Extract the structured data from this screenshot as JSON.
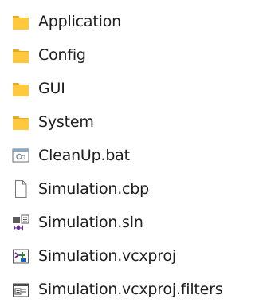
{
  "files": [
    {
      "name": "Application",
      "type": "folder",
      "icon": "folder-icon"
    },
    {
      "name": "Config",
      "type": "folder",
      "icon": "folder-icon"
    },
    {
      "name": "GUI",
      "type": "folder",
      "icon": "folder-icon"
    },
    {
      "name": "System",
      "type": "folder",
      "icon": "folder-icon"
    },
    {
      "name": "CleanUp.bat",
      "type": "batch",
      "icon": "batch-file-icon"
    },
    {
      "name": "Simulation.cbp",
      "type": "generic",
      "icon": "generic-file-icon"
    },
    {
      "name": "Simulation.sln",
      "type": "solution",
      "icon": "visual-studio-solution-icon"
    },
    {
      "name": "Simulation.vcxproj",
      "type": "project",
      "icon": "vcxproj-file-icon"
    },
    {
      "name": "Simulation.vcxproj.filters",
      "type": "filters",
      "icon": "filters-file-icon"
    }
  ],
  "colors": {
    "folder": "#FFC83D",
    "folder_shade": "#E8A920",
    "text": "#1f1f1f"
  }
}
